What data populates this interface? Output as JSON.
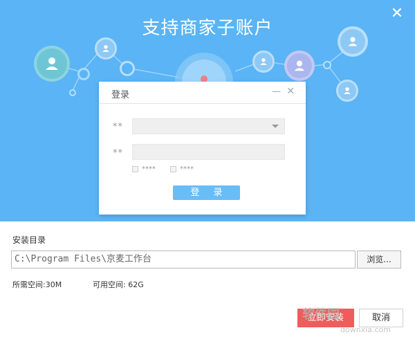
{
  "window": {
    "title": "支持商家子账户",
    "close_glyph": "✕"
  },
  "login_dialog": {
    "title": "登录",
    "min_glyph": "—",
    "close_glyph": "✕",
    "field1_label": "**",
    "field2_label": "**",
    "checkbox1_label": "****",
    "checkbox2_label": "****",
    "login_button": "登 录"
  },
  "install": {
    "dir_label": "安装目录",
    "path_value": "C:\\Program Files\\京麦工作台",
    "browse_button": "浏览...",
    "required_space": "所需空间:30M",
    "available_space": "可用空间: 62G",
    "install_button": "立即安装",
    "cancel_button": "取消"
  },
  "watermark": {
    "brand": "软件园",
    "url": "downxia.com"
  },
  "colors": {
    "hero_bg": "#5ab4f5",
    "accent_red": "#f05b5b",
    "login_button": "#69bdf7"
  },
  "icons": [
    "user-avatar-icon",
    "close-icon",
    "dropdown-arrow-icon",
    "minimize-icon"
  ]
}
